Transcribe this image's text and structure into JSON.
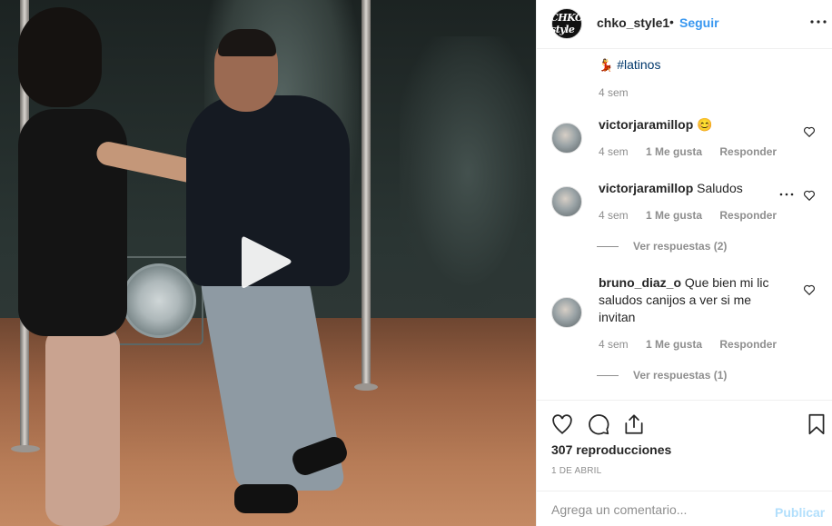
{
  "header": {
    "avatar_text": "CHKO style",
    "username": "chko_style1",
    "separator": "•",
    "follow_label": "Seguir",
    "more_icon": "more-horizontal-icon"
  },
  "caption": {
    "emoji": "💃",
    "hashtag": "#latinos",
    "time": "4 sem"
  },
  "comments": [
    {
      "username": "victorjaramillop",
      "text": "😊",
      "time": "4 sem",
      "likes": "1 Me gusta",
      "reply": "Responder"
    },
    {
      "username": "victorjaramillop",
      "text": "Saludos",
      "time": "4 sem",
      "likes": "1 Me gusta",
      "reply": "Responder",
      "view_replies": "Ver respuestas (2)"
    },
    {
      "username": "bruno_diaz_o",
      "text": "Que bien mi lic saludos canijos a ver si me invitan",
      "time": "4 sem",
      "likes": "1 Me gusta",
      "reply": "Responder",
      "view_replies": "Ver respuestas (1)"
    }
  ],
  "actions": {
    "views": "307 reproducciones",
    "date": "1 DE ABRIL"
  },
  "add_comment": {
    "placeholder": "Agrega un comentario...",
    "publish_label": "Publicar"
  },
  "colors": {
    "link_blue": "#3897f0",
    "publish_disabled": "#b2dffc",
    "muted_text": "#8e8e8e",
    "hashtag": "#00376b"
  }
}
